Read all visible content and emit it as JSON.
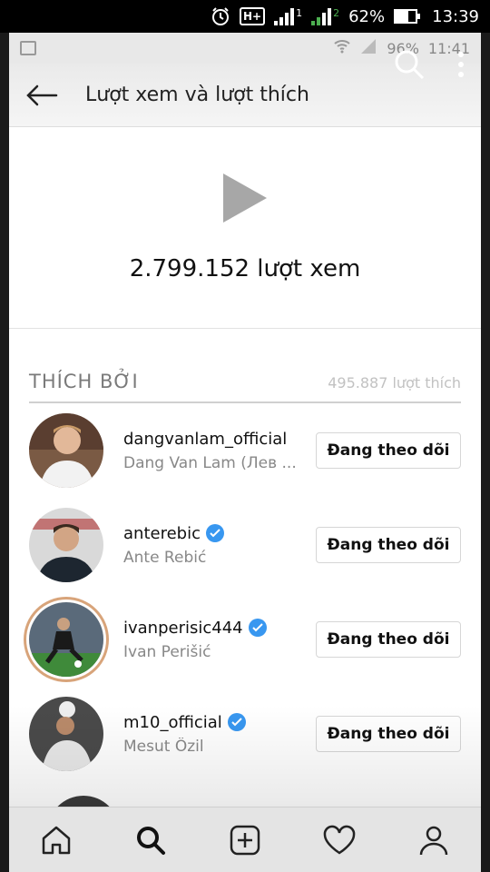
{
  "phone_status": {
    "network": "H+",
    "sim1": "1",
    "sim2": "2",
    "battery": "62%",
    "time": "13:39"
  },
  "inner_status": {
    "battery": "96%",
    "time": "11:41"
  },
  "header": {
    "title": "Lượt xem và lượt thích"
  },
  "views": {
    "count_text": "2.799.152 lượt xem"
  },
  "liked_by": {
    "title": "THÍCH BỞI",
    "count_text": "495.887 lượt thích",
    "users": [
      {
        "username": "dangvanlam_official",
        "fullname": "Dang Van Lam (Лев ...",
        "verified": false,
        "button": "Đang theo dõi"
      },
      {
        "username": "anterebic",
        "fullname": "Ante Rebić",
        "verified": true,
        "button": "Đang theo dõi"
      },
      {
        "username": "ivanperisic444",
        "fullname": "Ivan Perišić",
        "verified": true,
        "button": "Đang theo dõi"
      },
      {
        "username": "m10_official",
        "fullname": "Mesut Özil",
        "verified": true,
        "button": "Đang theo dõi"
      }
    ]
  },
  "nav": {
    "icons": [
      "home-icon",
      "search-icon",
      "add-post-icon",
      "heart-icon",
      "profile-icon"
    ]
  },
  "colors": {
    "verified": "#3897f0",
    "story_ring": "#d8a47a",
    "secondary_text": "#888888"
  }
}
